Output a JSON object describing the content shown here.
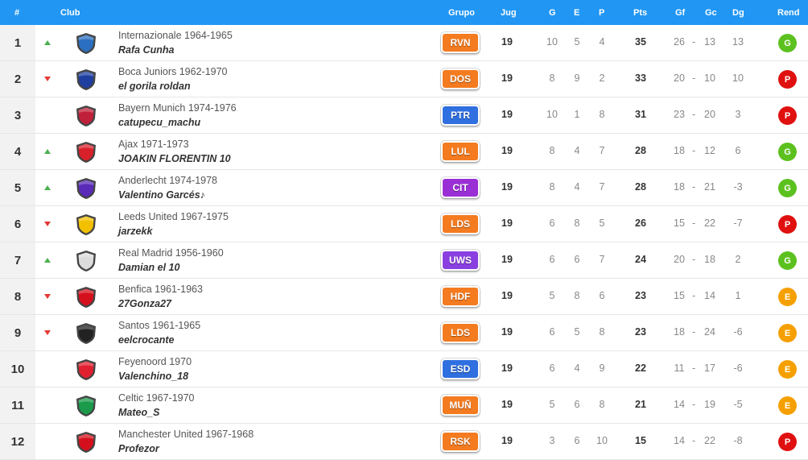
{
  "header": {
    "pos": "#",
    "club": "Club",
    "group": "Grupo",
    "played": "Jug",
    "won": "G",
    "drawn": "E",
    "lost": "P",
    "points": "Pts",
    "gf": "Gf",
    "gc": "Gc",
    "gd": "Dg",
    "form": "Rend"
  },
  "colors": {
    "header_bg": "#2196f3",
    "trend_up": "#4caf50",
    "trend_down": "#e53935",
    "form_G": "#5cc11e",
    "form_P": "#e01010",
    "form_E": "#f5a000",
    "group_orange": "#f47b20",
    "group_purple": "#9b2fd6",
    "group_blue": "#2f6fe0",
    "group_violet": "#8a40e0"
  },
  "rows": [
    {
      "pos": "1",
      "trend": "up",
      "crest": "#2b6fc1",
      "club": "Internazionale 1964-1965",
      "user": "Rafa Cunha",
      "group": "RVN",
      "gcolor": "#f47b20",
      "played": "19",
      "won": "10",
      "drawn": "5",
      "lost": "4",
      "points": "35",
      "gf": "26",
      "gc": "13",
      "gd": "13",
      "form": "G"
    },
    {
      "pos": "2",
      "trend": "down",
      "crest": "#1e3fa0",
      "club": "Boca Juniors 1962-1970",
      "user": "el gorila roldan",
      "group": "DOS",
      "gcolor": "#f47b20",
      "played": "19",
      "won": "8",
      "drawn": "9",
      "lost": "2",
      "points": "33",
      "gf": "20",
      "gc": "10",
      "gd": "10",
      "form": "P"
    },
    {
      "pos": "3",
      "trend": "none",
      "crest": "#c0203a",
      "club": "Bayern Munich 1974-1976",
      "user": "catupecu_machu",
      "group": "PTR",
      "gcolor": "#2f6fe0",
      "played": "19",
      "won": "10",
      "drawn": "1",
      "lost": "8",
      "points": "31",
      "gf": "23",
      "gc": "20",
      "gd": "3",
      "form": "P"
    },
    {
      "pos": "4",
      "trend": "up",
      "crest": "#d8202a",
      "club": "Ajax 1971-1973",
      "user": "JOAKIN FLORENTIN 10",
      "group": "LUL",
      "gcolor": "#f47b20",
      "played": "19",
      "won": "8",
      "drawn": "4",
      "lost": "7",
      "points": "28",
      "gf": "18",
      "gc": "12",
      "gd": "6",
      "form": "G"
    },
    {
      "pos": "5",
      "trend": "up",
      "crest": "#5a2ab8",
      "club": "Anderlecht 1974-1978",
      "user": "Valentino Garcés♪",
      "group": "CIT",
      "gcolor": "#9b2fd6",
      "played": "19",
      "won": "8",
      "drawn": "4",
      "lost": "7",
      "points": "28",
      "gf": "18",
      "gc": "21",
      "gd": "-3",
      "form": "G"
    },
    {
      "pos": "6",
      "trend": "down",
      "crest": "#f3c000",
      "club": "Leeds United 1967-1975",
      "user": "jarzekk",
      "group": "LDS",
      "gcolor": "#f47b20",
      "played": "19",
      "won": "6",
      "drawn": "8",
      "lost": "5",
      "points": "26",
      "gf": "15",
      "gc": "22",
      "gd": "-7",
      "form": "P"
    },
    {
      "pos": "7",
      "trend": "up",
      "crest": "#dcdcdc",
      "club": "Real Madrid 1956-1960",
      "user": "Damian el 10",
      "group": "UWS",
      "gcolor": "#8a40e0",
      "played": "19",
      "won": "6",
      "drawn": "6",
      "lost": "7",
      "points": "24",
      "gf": "20",
      "gc": "18",
      "gd": "2",
      "form": "G"
    },
    {
      "pos": "8",
      "trend": "down",
      "crest": "#d4101c",
      "club": "Benfica 1961-1963",
      "user": "27Gonza27",
      "group": "HDF",
      "gcolor": "#f47b20",
      "played": "19",
      "won": "5",
      "drawn": "8",
      "lost": "6",
      "points": "23",
      "gf": "15",
      "gc": "14",
      "gd": "1",
      "form": "E"
    },
    {
      "pos": "9",
      "trend": "down",
      "crest": "#222222",
      "club": "Santos 1961-1965",
      "user": "eelcrocante",
      "group": "LDS",
      "gcolor": "#f47b20",
      "played": "19",
      "won": "6",
      "drawn": "5",
      "lost": "8",
      "points": "23",
      "gf": "18",
      "gc": "24",
      "gd": "-6",
      "form": "E"
    },
    {
      "pos": "10",
      "trend": "none",
      "crest": "#e02030",
      "club": "Feyenoord 1970",
      "user": "Valenchino_18",
      "group": "ESD",
      "gcolor": "#2f6fe0",
      "played": "19",
      "won": "6",
      "drawn": "4",
      "lost": "9",
      "points": "22",
      "gf": "11",
      "gc": "17",
      "gd": "-6",
      "form": "E"
    },
    {
      "pos": "11",
      "trend": "none",
      "crest": "#1a9a4a",
      "club": "Celtic 1967-1970",
      "user": "Mateo_S",
      "group": "MUÑ",
      "gcolor": "#f47b20",
      "played": "19",
      "won": "5",
      "drawn": "6",
      "lost": "8",
      "points": "21",
      "gf": "14",
      "gc": "19",
      "gd": "-5",
      "form": "E"
    },
    {
      "pos": "12",
      "trend": "none",
      "crest": "#d4101c",
      "club": "Manchester United 1967-1968",
      "user": "Profezor",
      "group": "RSK",
      "gcolor": "#f47b20",
      "played": "19",
      "won": "3",
      "drawn": "6",
      "lost": "10",
      "points": "15",
      "gf": "14",
      "gc": "22",
      "gd": "-8",
      "form": "P"
    }
  ]
}
